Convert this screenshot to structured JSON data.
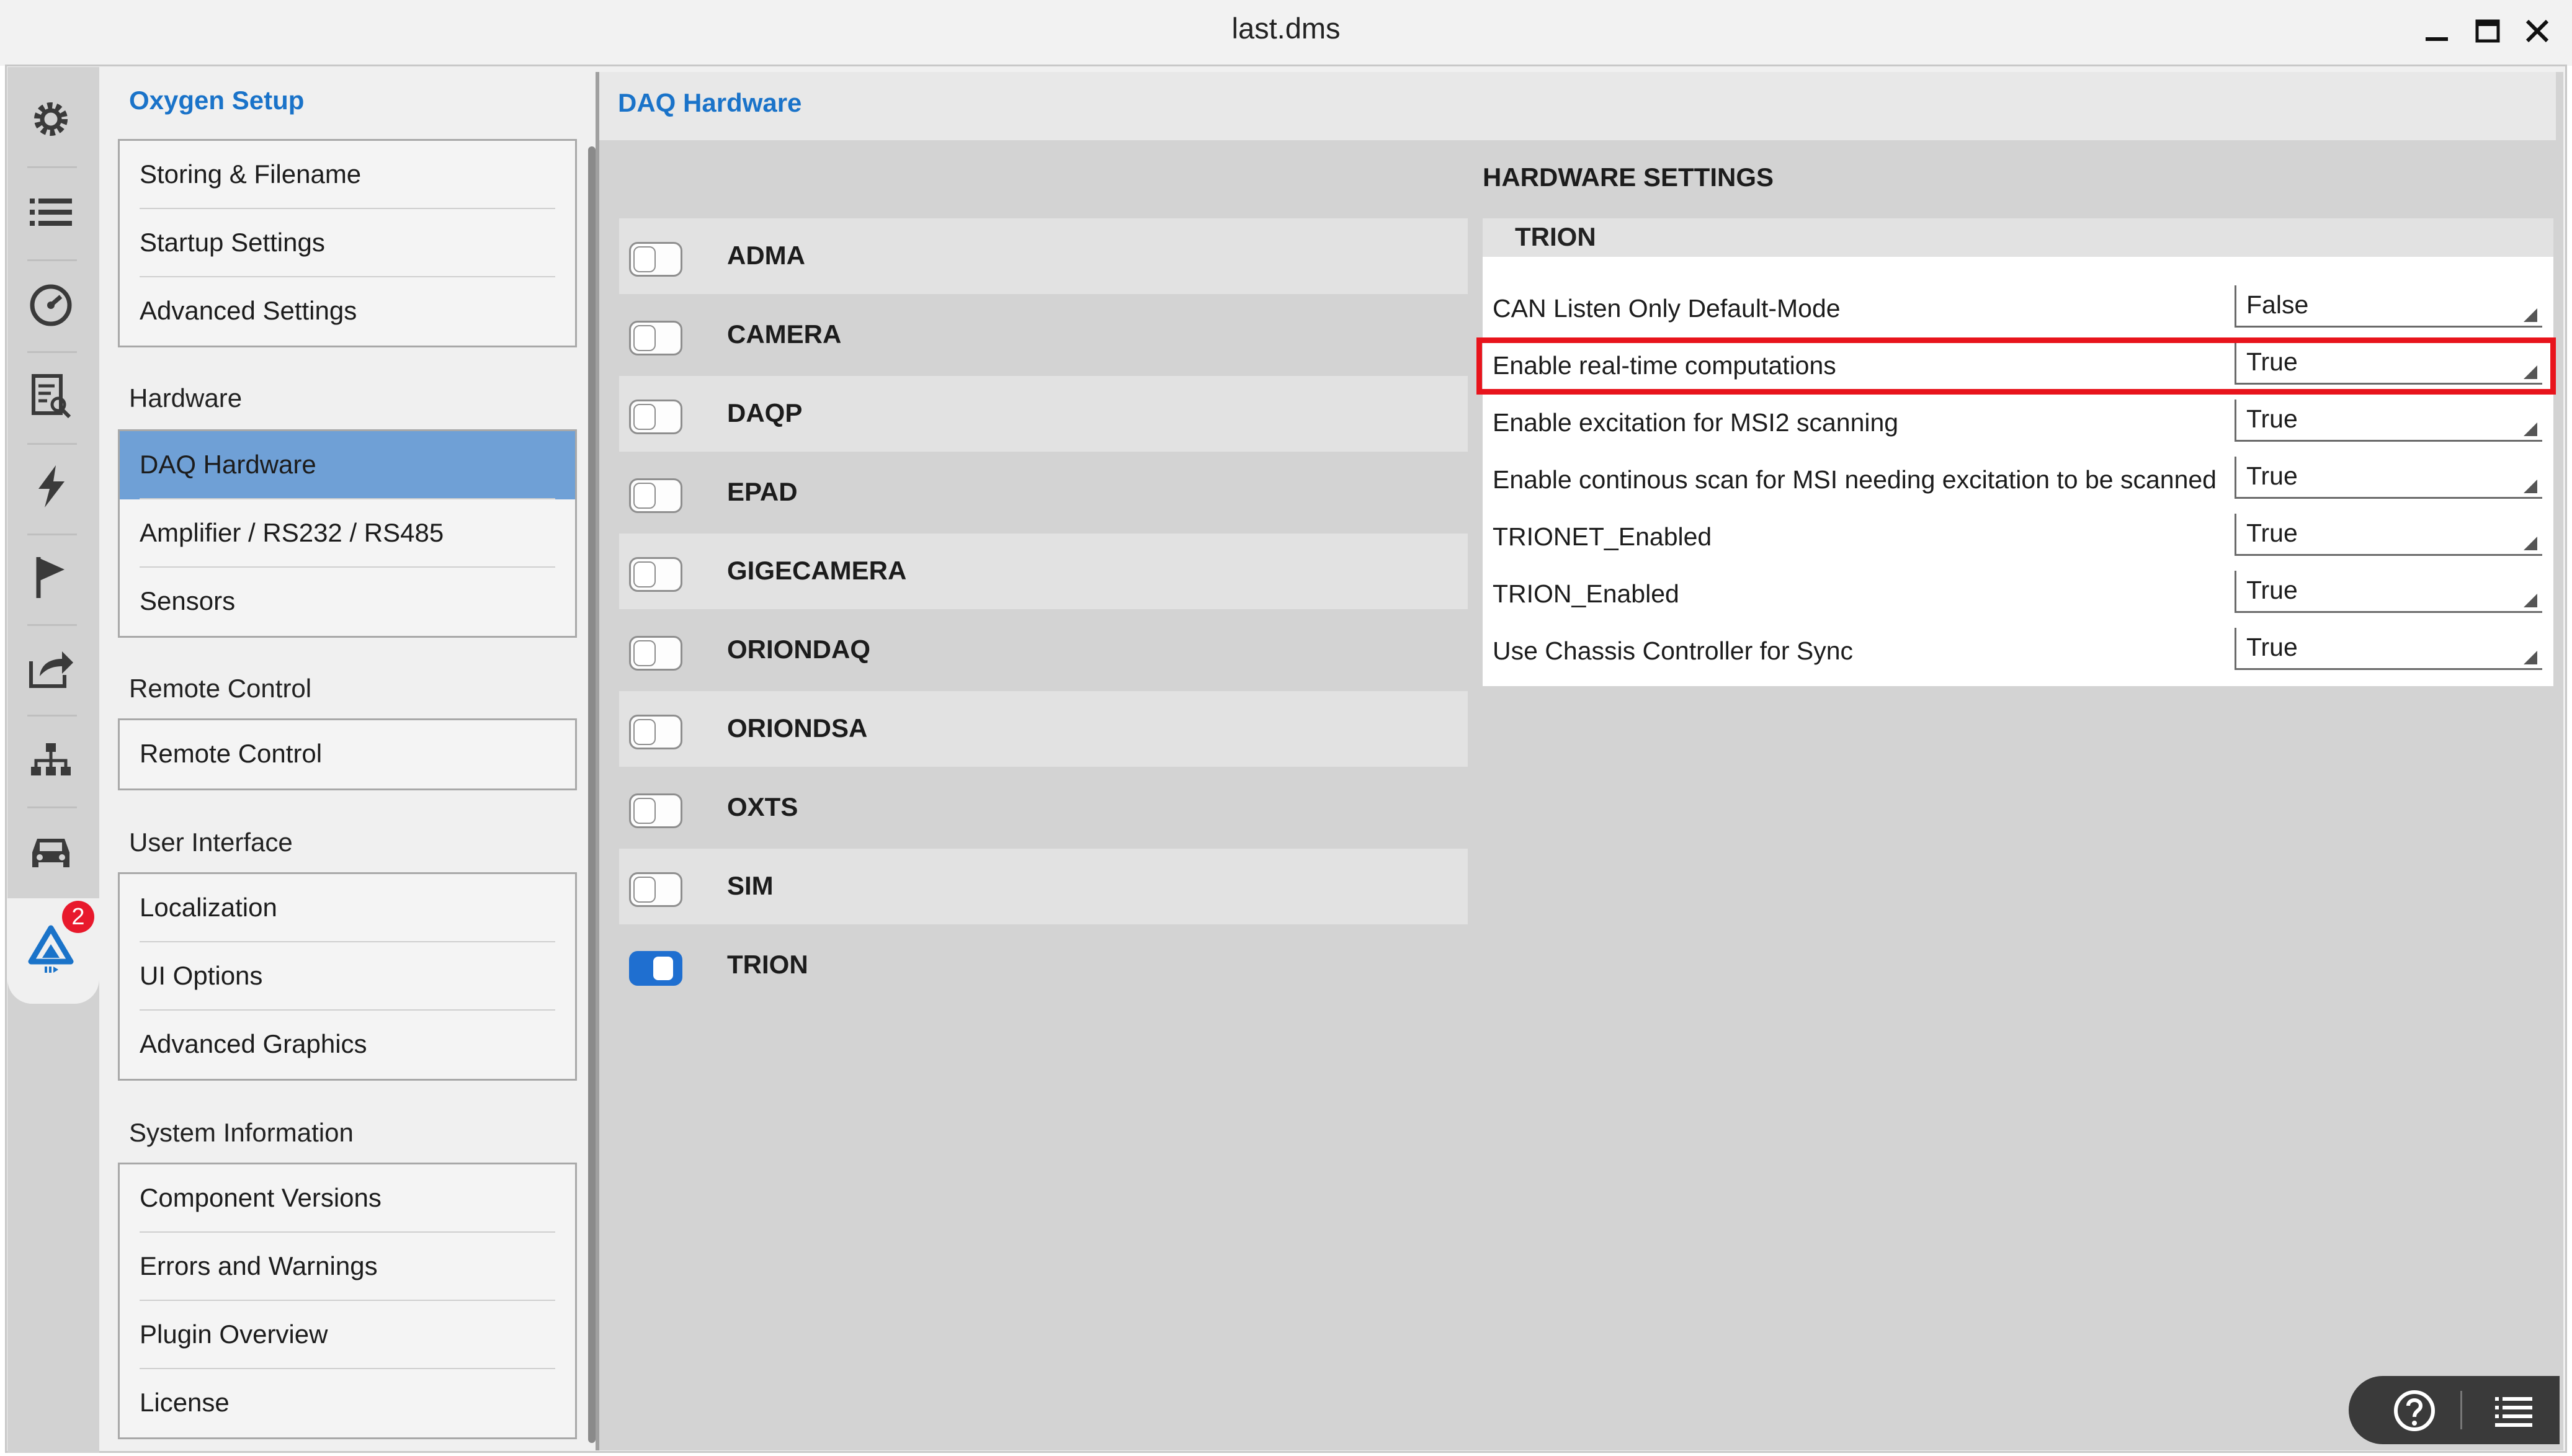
{
  "window": {
    "title": "last.dms"
  },
  "rail": {
    "icons": [
      "gear-icon",
      "list-icon",
      "gauge-icon",
      "report-icon",
      "bolt-icon",
      "flag-icon",
      "export-icon",
      "network-icon",
      "car-icon",
      "oxygen-logo-icon"
    ],
    "badge_count": "2"
  },
  "nav": {
    "header": "Oxygen Setup",
    "groups": [
      {
        "title": "",
        "items": [
          "Storing & Filename",
          "Startup Settings",
          "Advanced Settings"
        ]
      },
      {
        "title": "Hardware",
        "items": [
          "DAQ Hardware",
          "Amplifier / RS232 / RS485",
          "Sensors"
        ]
      },
      {
        "title": "Remote Control",
        "items": [
          "Remote Control"
        ]
      },
      {
        "title": "User Interface",
        "items": [
          "Localization",
          "UI Options",
          "Advanced Graphics"
        ]
      },
      {
        "title": "System Information",
        "items": [
          "Component Versions",
          "Errors and Warnings",
          "Plugin Overview",
          "License"
        ]
      }
    ],
    "selected": "DAQ Hardware"
  },
  "main": {
    "title": "DAQ Hardware",
    "plugins": [
      {
        "name": "ADMA",
        "enabled": false
      },
      {
        "name": "CAMERA",
        "enabled": false
      },
      {
        "name": "DAQP",
        "enabled": false
      },
      {
        "name": "EPAD",
        "enabled": false
      },
      {
        "name": "GIGECAMERA",
        "enabled": false
      },
      {
        "name": "ORIONDAQ",
        "enabled": false
      },
      {
        "name": "ORIONDSA",
        "enabled": false
      },
      {
        "name": "OXTS",
        "enabled": false
      },
      {
        "name": "SIM",
        "enabled": false
      },
      {
        "name": "TRION",
        "enabled": true
      }
    ]
  },
  "hardware_settings": {
    "title": "HARDWARE SETTINGS",
    "section": "TRION",
    "rows": [
      {
        "label": "CAN Listen Only Default-Mode",
        "value": "False"
      },
      {
        "label": "Enable real-time computations",
        "value": "True"
      },
      {
        "label": "Enable excitation for MSI2 scanning",
        "value": "True"
      },
      {
        "label": "Enable continous scan for MSI needing excitation to be scanned",
        "value": "True"
      },
      {
        "label": "TRIONET_Enabled",
        "value": "True"
      },
      {
        "label": "TRION_Enabled",
        "value": "True"
      },
      {
        "label": "Use Chassis Controller for Sync",
        "value": "True"
      }
    ],
    "highlighted_row": "Enable real-time computations",
    "highlight_color": "#e8141c"
  },
  "bottom_bar": {
    "icons": [
      "help-icon",
      "menu-list-icon"
    ]
  },
  "colors": {
    "accent": "#1a73c9",
    "selected_nav": "#6fa0d6",
    "toggle_on": "#1f6fd0"
  }
}
